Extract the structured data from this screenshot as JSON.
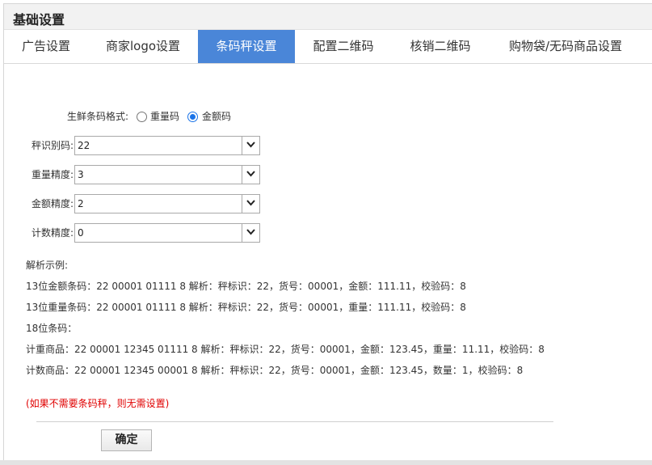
{
  "title": "基础设置",
  "tabs": [
    {
      "label": "广告设置",
      "active": false
    },
    {
      "label": "商家logo设置",
      "active": false
    },
    {
      "label": "条码秤设置",
      "active": true
    },
    {
      "label": "配置二维码",
      "active": false
    },
    {
      "label": "核销二维码",
      "active": false
    },
    {
      "label": "购物袋/无码商品设置",
      "active": false
    }
  ],
  "fresh_format": {
    "label": "生鲜条码格式:",
    "options": [
      {
        "label": "重量码",
        "checked": false
      },
      {
        "label": "金额码",
        "checked": true
      }
    ]
  },
  "fields": [
    {
      "label": "秤识别码:",
      "value": "22"
    },
    {
      "label": "重量精度:",
      "value": "3"
    },
    {
      "label": "金额精度:",
      "value": "2"
    },
    {
      "label": "计数精度:",
      "value": "0"
    }
  ],
  "examples": {
    "heading": "解析示例:",
    "lines": [
      "13位金额条码：22 00001 01111 8 解析：秤标识：22，货号：00001，金额：111.11，校验码：8",
      "13位重量条码：22 00001 01111 8 解析：秤标识：22，货号：00001，重量：111.11，校验码：8",
      "18位条码：",
      "计重商品：22 00001 12345 01111 8 解析：秤标识：22，货号：00001，金额：123.45，重量：11.11，校验码：8",
      "计数商品：22 00001 12345 00001 8 解析：秤标识：22，货号：00001，金额：123.45，数量：1，校验码：8"
    ]
  },
  "note": "(如果不需要条码秤，则无需设置)",
  "confirm_label": "确定",
  "colors": {
    "accent": "#4a86d8",
    "note": "#e00000",
    "radio_checked": "#1a73e8"
  }
}
